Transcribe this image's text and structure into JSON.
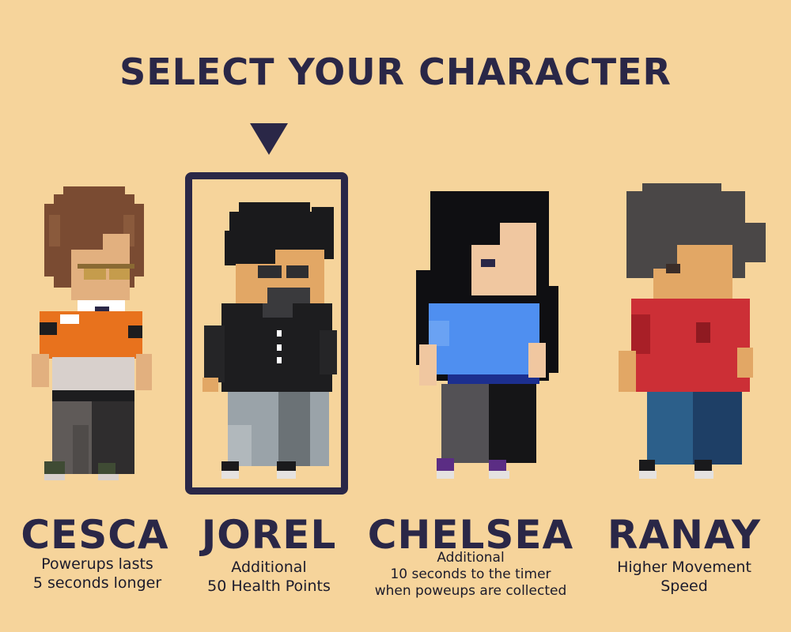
{
  "screen": {
    "title": "SELECT YOUR CHARACTER",
    "selected_character": "JOREL",
    "selector_icon": "triangle-down-icon"
  },
  "characters": [
    {
      "name": "CESCA",
      "desc_lines": [
        "Powerups lasts",
        "5 seconds longer"
      ],
      "selected": false
    },
    {
      "name": "JOREL",
      "desc_lines": [
        "Additional",
        "50 Health Points"
      ],
      "selected": true
    },
    {
      "name": "CHELSEA",
      "desc_lines": [
        "Additional",
        "10 seconds to the timer",
        "when poweups are collected"
      ],
      "selected": false
    },
    {
      "name": "RANAY",
      "desc_lines": [
        "Higher Movement",
        "Speed"
      ],
      "selected": false
    }
  ],
  "colors": {
    "background": "#f6d49b",
    "text": "#2a2747",
    "skin": "#e2b07f",
    "cesca_shirt": "#e8721d",
    "jorel_jacket": "#1d1d1f",
    "chelsea_shirt": "#4f8ff0",
    "ranay_shirt": "#cc2f36"
  }
}
